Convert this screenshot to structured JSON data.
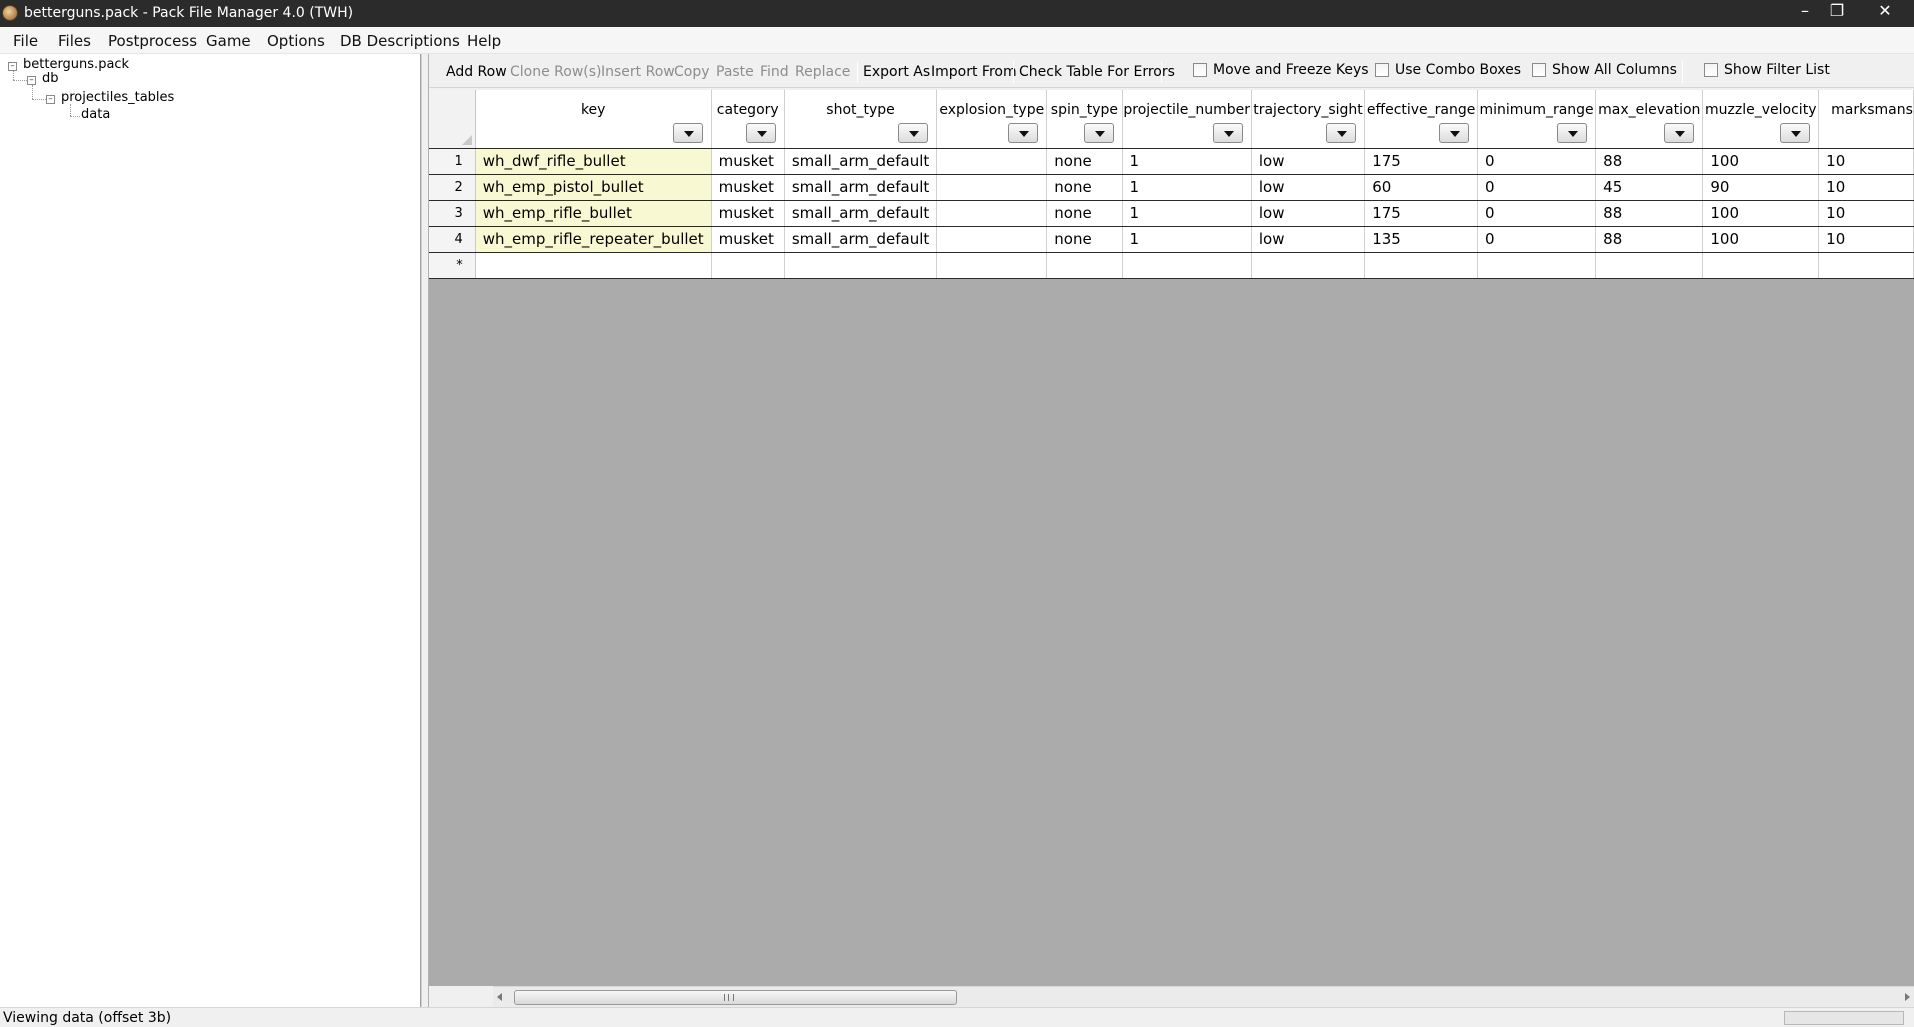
{
  "window": {
    "title": "betterguns.pack - Pack File Manager 4.0 (TWH)",
    "minimize": "–",
    "maximize": "❐",
    "close": "✕"
  },
  "menu": [
    "File",
    "Files",
    "Postprocess",
    "Game",
    "Options",
    "DB Descriptions",
    "Help"
  ],
  "tree": {
    "root": "betterguns.pack",
    "db": "db",
    "table": "projectiles_tables",
    "leaf": "data"
  },
  "toolbar": {
    "add_row": "Add Row",
    "clone_rows": "Clone Row(s)",
    "insert_row": "Insert Row",
    "copy": "Copy",
    "paste": "Paste",
    "find": "Find",
    "replace": "Replace",
    "export_as": "Export As",
    "import_from": "Import From",
    "check_table": "Check Table For Errors",
    "move_freeze": "Move and Freeze Keys",
    "use_combo": "Use Combo Boxes",
    "show_all_columns": "Show All Columns",
    "show_filter_list": "Show Filter List"
  },
  "grid": {
    "columns": [
      "key",
      "category",
      "shot_type",
      "explosion_type",
      "spin_type",
      "projectile_number",
      "trajectory_sight",
      "effective_range",
      "minimum_range",
      "max_elevation",
      "muzzle_velocity",
      "marksmans"
    ],
    "rows": [
      {
        "num": "1",
        "cells": [
          "wh_dwf_rifle_bullet",
          "musket",
          "small_arm_default",
          "",
          "none",
          "1",
          "low",
          "175",
          "0",
          "88",
          "100",
          "10"
        ]
      },
      {
        "num": "2",
        "cells": [
          "wh_emp_pistol_bullet",
          "musket",
          "small_arm_default",
          "",
          "none",
          "1",
          "low",
          "60",
          "0",
          "45",
          "90",
          "10"
        ]
      },
      {
        "num": "3",
        "cells": [
          "wh_emp_rifle_bullet",
          "musket",
          "small_arm_default",
          "",
          "none",
          "1",
          "low",
          "175",
          "0",
          "88",
          "100",
          "10"
        ]
      },
      {
        "num": "4",
        "cells": [
          "wh_emp_rifle_repeater_bullet",
          "musket",
          "small_arm_default",
          "",
          "none",
          "1",
          "low",
          "135",
          "0",
          "88",
          "100",
          "10"
        ]
      }
    ],
    "new_row_marker": "*"
  },
  "status": {
    "text": "Viewing data (offset 3b)"
  },
  "colors": {
    "key_cell": "#f8f8d2",
    "grid_background": "#ababab",
    "titlebar": "#2b2b2b"
  }
}
